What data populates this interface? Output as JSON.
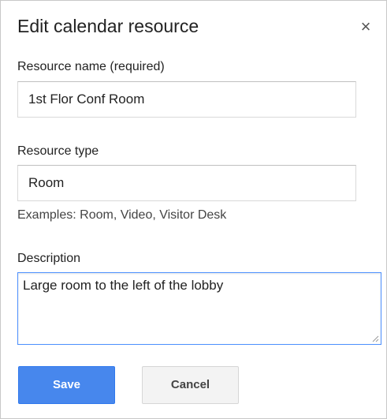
{
  "dialog": {
    "title": "Edit calendar resource",
    "close_icon": "close-icon",
    "close_glyph": "×"
  },
  "form": {
    "resource_name": {
      "label": "Resource name (required)",
      "value": "1st Flor Conf Room"
    },
    "resource_type": {
      "label": "Resource type",
      "value": "Room",
      "hint": "Examples: Room, Video, Visitor Desk"
    },
    "description": {
      "label": "Description",
      "value": "Large room to the left of the lobby"
    }
  },
  "actions": {
    "save_label": "Save",
    "cancel_label": "Cancel"
  },
  "colors": {
    "primary_button": "#4787ed",
    "focus_border": "#4d90fe",
    "secondary_button": "#f3f3f3"
  }
}
